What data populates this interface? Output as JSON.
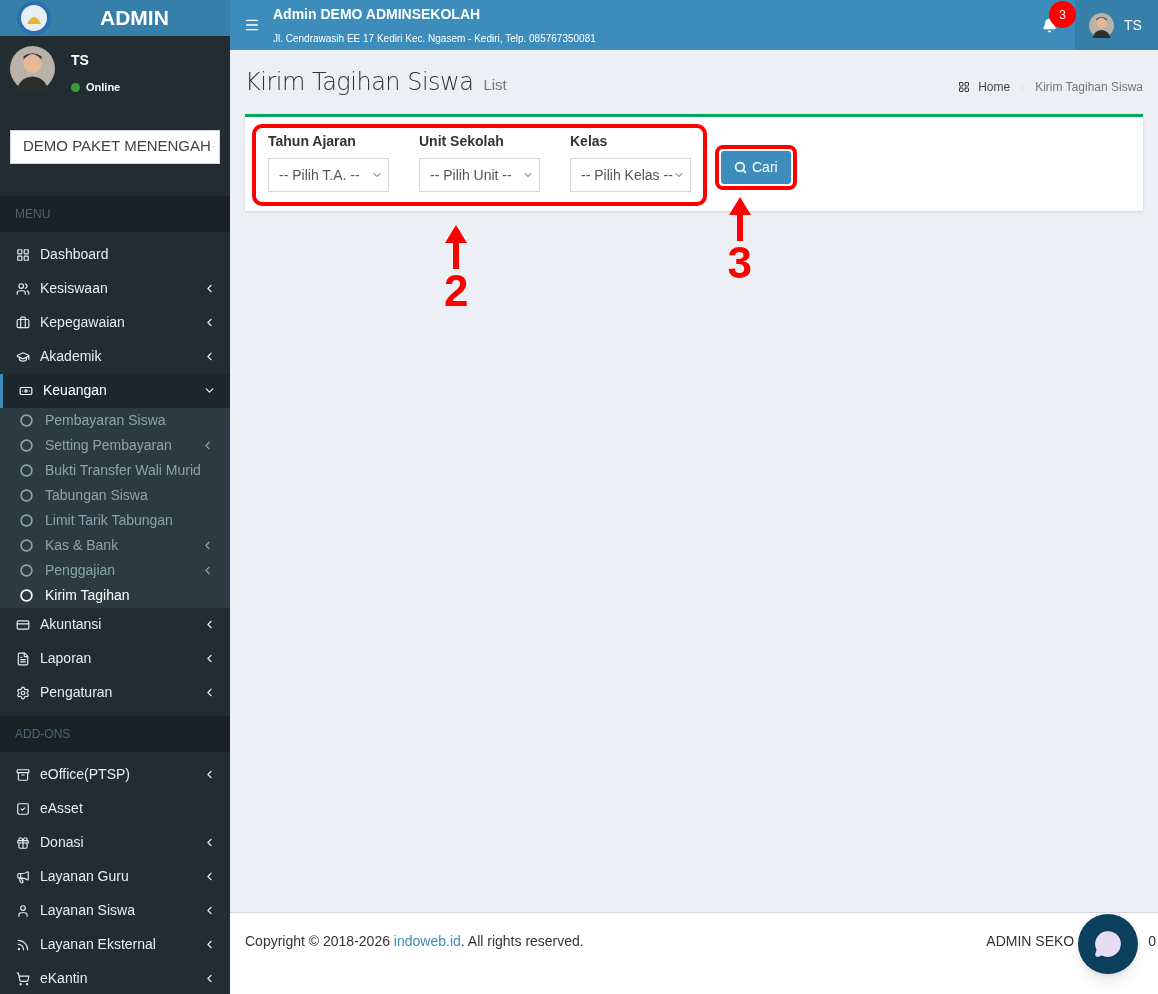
{
  "sidebar": {
    "brand": "ADMIN",
    "user": {
      "name": "TS",
      "status": "Online",
      "online": true
    },
    "school_select": {
      "value": "DEMO PAKET MENENGAH"
    },
    "sections": [
      {
        "header": "MENU",
        "items": [
          {
            "label": "Dashboard",
            "expandable": false,
            "expanded": false
          },
          {
            "label": "Kesiswaan",
            "expandable": true,
            "expanded": false
          },
          {
            "label": "Kepegawaian",
            "expandable": true,
            "expanded": false
          },
          {
            "label": "Akademik",
            "expandable": true,
            "expanded": false
          },
          {
            "label": "Keuangan",
            "expandable": true,
            "expanded": true,
            "children": [
              {
                "label": "Pembayaran Siswa",
                "expandable": false,
                "selected": false
              },
              {
                "label": "Setting Pembayaran",
                "expandable": true,
                "selected": false
              },
              {
                "label": "Bukti Transfer Wali Murid",
                "expandable": false,
                "selected": false
              },
              {
                "label": "Tabungan Siswa",
                "expandable": false,
                "selected": false
              },
              {
                "label": "Limit Tarik Tabungan",
                "expandable": false,
                "selected": false
              },
              {
                "label": "Kas & Bank",
                "expandable": true,
                "selected": false
              },
              {
                "label": "Penggajian",
                "expandable": true,
                "selected": false
              },
              {
                "label": "Kirim Tagihan",
                "expandable": false,
                "selected": true
              }
            ]
          },
          {
            "label": "Akuntansi",
            "expandable": true,
            "expanded": false
          },
          {
            "label": "Laporan",
            "expandable": true,
            "expanded": false
          },
          {
            "label": "Pengaturan",
            "expandable": true,
            "expanded": false
          }
        ]
      },
      {
        "header": "ADD-ONS",
        "items": [
          {
            "label": "eOffice(PTSP)",
            "expandable": true,
            "expanded": false
          },
          {
            "label": "eAsset",
            "expandable": false,
            "expanded": false
          },
          {
            "label": "Donasi",
            "expandable": true,
            "expanded": false
          },
          {
            "label": "Layanan Guru",
            "expandable": true,
            "expanded": false
          },
          {
            "label": "Layanan Siswa",
            "expandable": true,
            "expanded": false
          },
          {
            "label": "Layanan Eksternal",
            "expandable": true,
            "expanded": false
          },
          {
            "label": "eKantin",
            "expandable": true,
            "expanded": false
          }
        ]
      }
    ]
  },
  "header": {
    "title": "Admin DEMO ADMINSEKOLAH",
    "address": "Jl. Cendrawasih EE 17 Kediri Kec. Ngasem - Kediri, Telp. 085767350081",
    "notification_count": "3",
    "user": "TS"
  },
  "page": {
    "title": "Kirim Tagihan Siswa",
    "subtitle": "List",
    "breadcrumb": [
      "Home",
      "Kirim Tagihan Siswa"
    ],
    "filters": [
      {
        "label": "Tahun Ajaran",
        "value": "-- Pilih T.A. --"
      },
      {
        "label": "Unit Sekolah",
        "value": "-- Pilih Unit --"
      },
      {
        "label": "Kelas",
        "value": "-- Pilih Kelas --"
      }
    ],
    "search_button": "Cari"
  },
  "annotations": [
    {
      "number": "2"
    },
    {
      "number": "3"
    }
  ],
  "footer": {
    "copyright_before": "Copyright © 2018-2026 ",
    "link": "indoweb.id",
    "copyright_after": ". All rights reserved.",
    "right_start": "ADMIN SEKO",
    "right_end": "0"
  }
}
